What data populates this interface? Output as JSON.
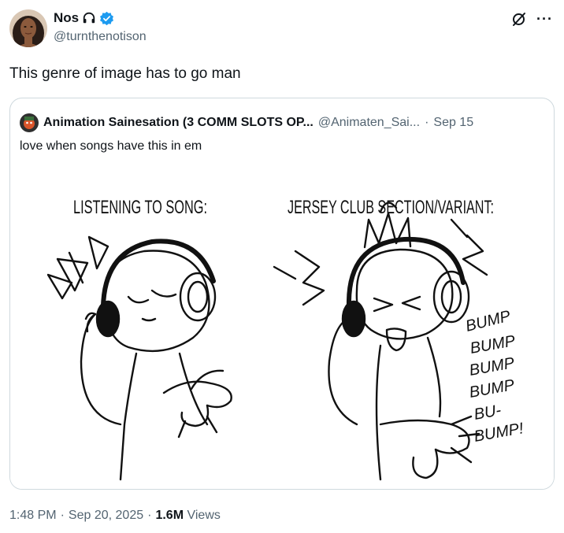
{
  "author": {
    "name": "Nos",
    "handle": "@turnthenotison",
    "icons": [
      "headphones-icon",
      "verified-badge-icon"
    ]
  },
  "tweet": {
    "text": "This genre of image has to go man"
  },
  "quote": {
    "name": "Animation Sainesation (3 COMM SLOTS OP...",
    "handle": "@Animaten_Sai...",
    "separator": "·",
    "date": "Sep 15",
    "text": "love when songs have this in em",
    "image": {
      "left_caption": "LISTENING TO SONG:",
      "right_caption": "JERSEY CLUB SECTION/VARIANT:",
      "sfx": [
        "BUMP",
        "BUMP",
        "BUMP",
        "BUMP",
        "BU-",
        "BUMP!"
      ]
    }
  },
  "meta": {
    "time": "1:48 PM",
    "separator1": "·",
    "date": "Sep 20, 2025",
    "separator2": "·",
    "views_count": "1.6M",
    "views_label": "Views"
  },
  "colors": {
    "verified": "#1d9bf0",
    "muted": "#536471",
    "border": "#cfd9de"
  }
}
